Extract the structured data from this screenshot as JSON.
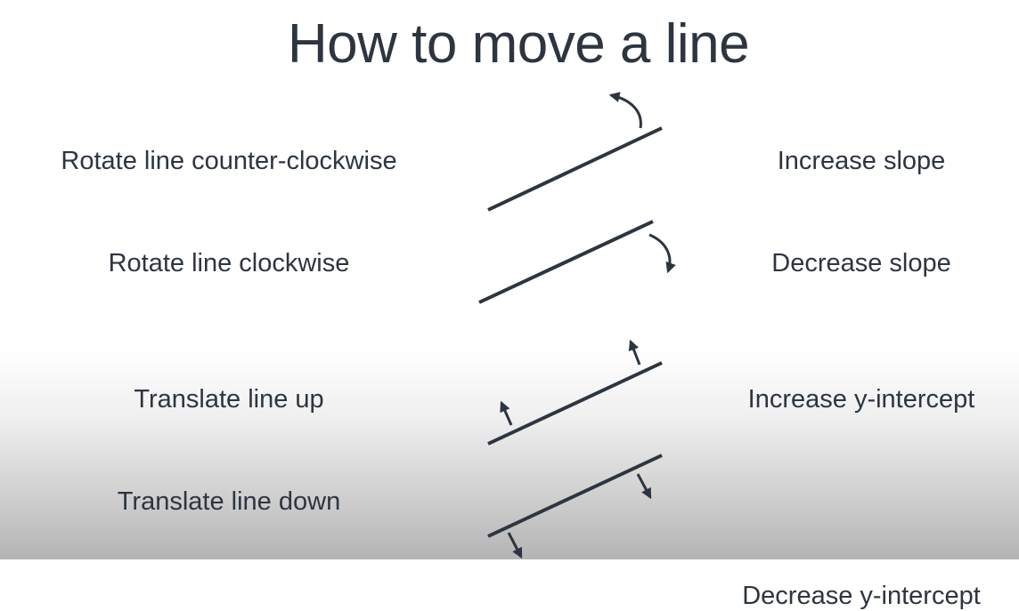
{
  "title": "How to move a line",
  "rows": [
    {
      "action": "Rotate line counter-clockwise",
      "effect": "Increase slope"
    },
    {
      "action": "Rotate line clockwise",
      "effect": "Decrease slope"
    },
    {
      "action": "Translate line up",
      "effect": "Increase y-intercept"
    },
    {
      "action": "Translate line down",
      "effect": "Decrease y-intercept"
    }
  ],
  "colors": {
    "text": "#2d3540",
    "line": "#2d3540",
    "background_top": "#ffffff",
    "background_bottom": "#b4b4b4"
  }
}
